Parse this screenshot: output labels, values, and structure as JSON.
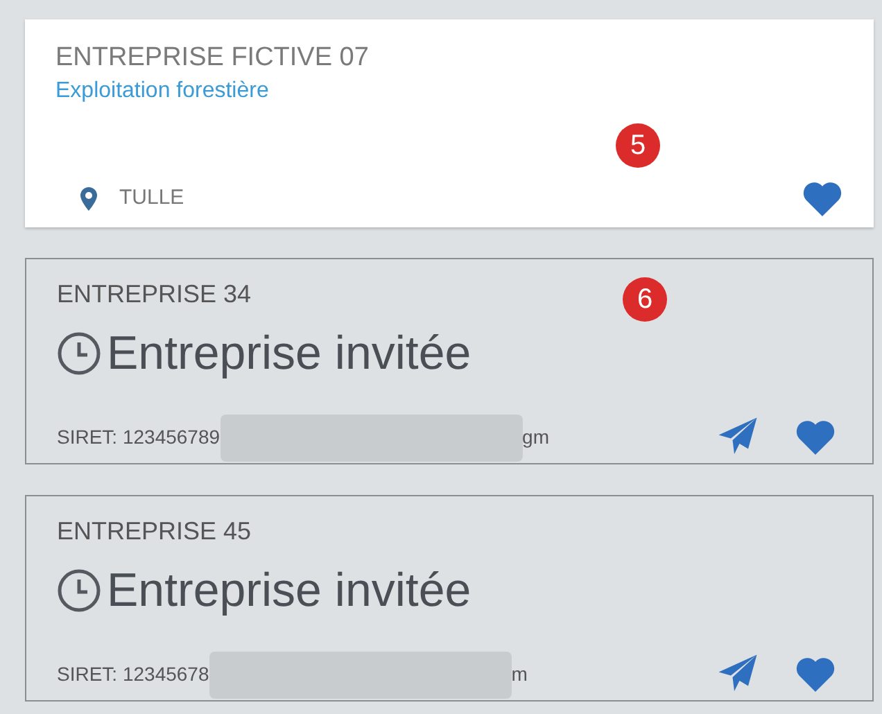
{
  "cards": [
    {
      "kind": "company",
      "name": "ENTREPRISE FICTIVE 07",
      "activity": "Exploitation forestière",
      "location": "TULLE",
      "badge": "5"
    },
    {
      "kind": "invited",
      "name": "ENTREPRISE 34",
      "status": "Entreprise invitée",
      "siret": "SIRET: 123456789",
      "siret_tail": "gm",
      "badge": "6"
    },
    {
      "kind": "invited",
      "name": "ENTREPRISE 45",
      "status": "Entreprise invitée",
      "siret": "SIRET: 12345678",
      "siret_tail": "m"
    }
  ]
}
